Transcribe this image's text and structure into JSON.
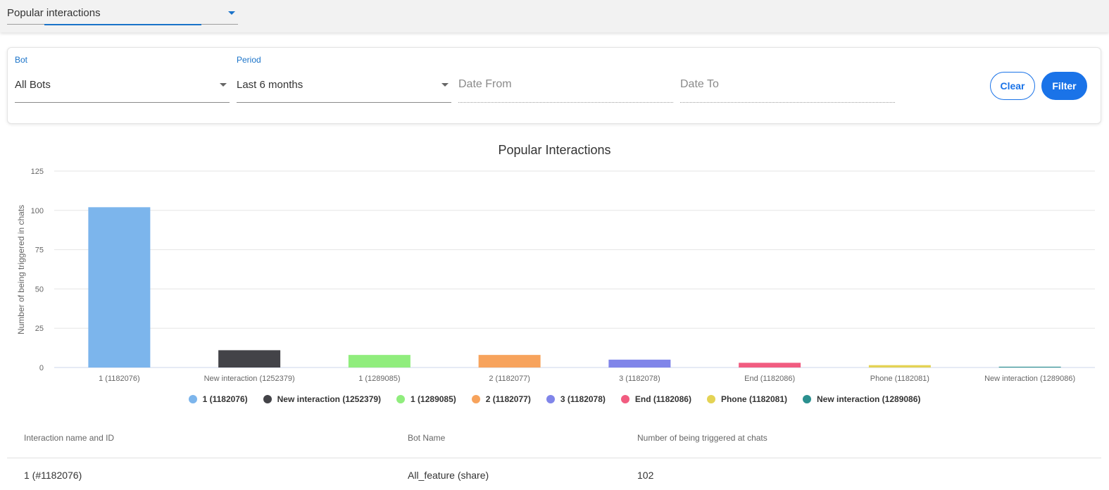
{
  "report_selector": {
    "value": "Popular interactions"
  },
  "filters": {
    "bot": {
      "label": "Bot",
      "value": "All Bots"
    },
    "period": {
      "label": "Period",
      "value": "Last 6 months"
    },
    "date_from": {
      "placeholder": "Date From"
    },
    "date_to": {
      "placeholder": "Date To"
    },
    "clear_label": "Clear",
    "filter_label": "Filter"
  },
  "chart_data": {
    "type": "bar",
    "title": "Popular Interactions",
    "xlabel": "",
    "ylabel": "Number of being triggered in chats",
    "ylim": [
      0,
      125
    ],
    "yticks": [
      0,
      25,
      50,
      75,
      100,
      125
    ],
    "grid": true,
    "legend_position": "bottom",
    "categories": [
      "1 (1182076)",
      "New interaction (1252379)",
      "1 (1289085)",
      "2 (1182077)",
      "3 (1182078)",
      "End (1182086)",
      "Phone (1182081)",
      "New interaction (1289086)"
    ],
    "values": [
      102,
      11,
      8,
      8,
      5,
      3,
      1.5,
      0.5
    ],
    "colors": [
      "#7cb5ec",
      "#434348",
      "#90ed7d",
      "#f7a35c",
      "#8085e9",
      "#f15c80",
      "#e4d354",
      "#2b908f"
    ]
  },
  "table": {
    "headers": [
      "Interaction name and ID",
      "Bot Name",
      "Number of being triggered at chats"
    ],
    "rows": [
      [
        "1 (#1182076)",
        "All_feature (share)",
        "102"
      ]
    ]
  }
}
